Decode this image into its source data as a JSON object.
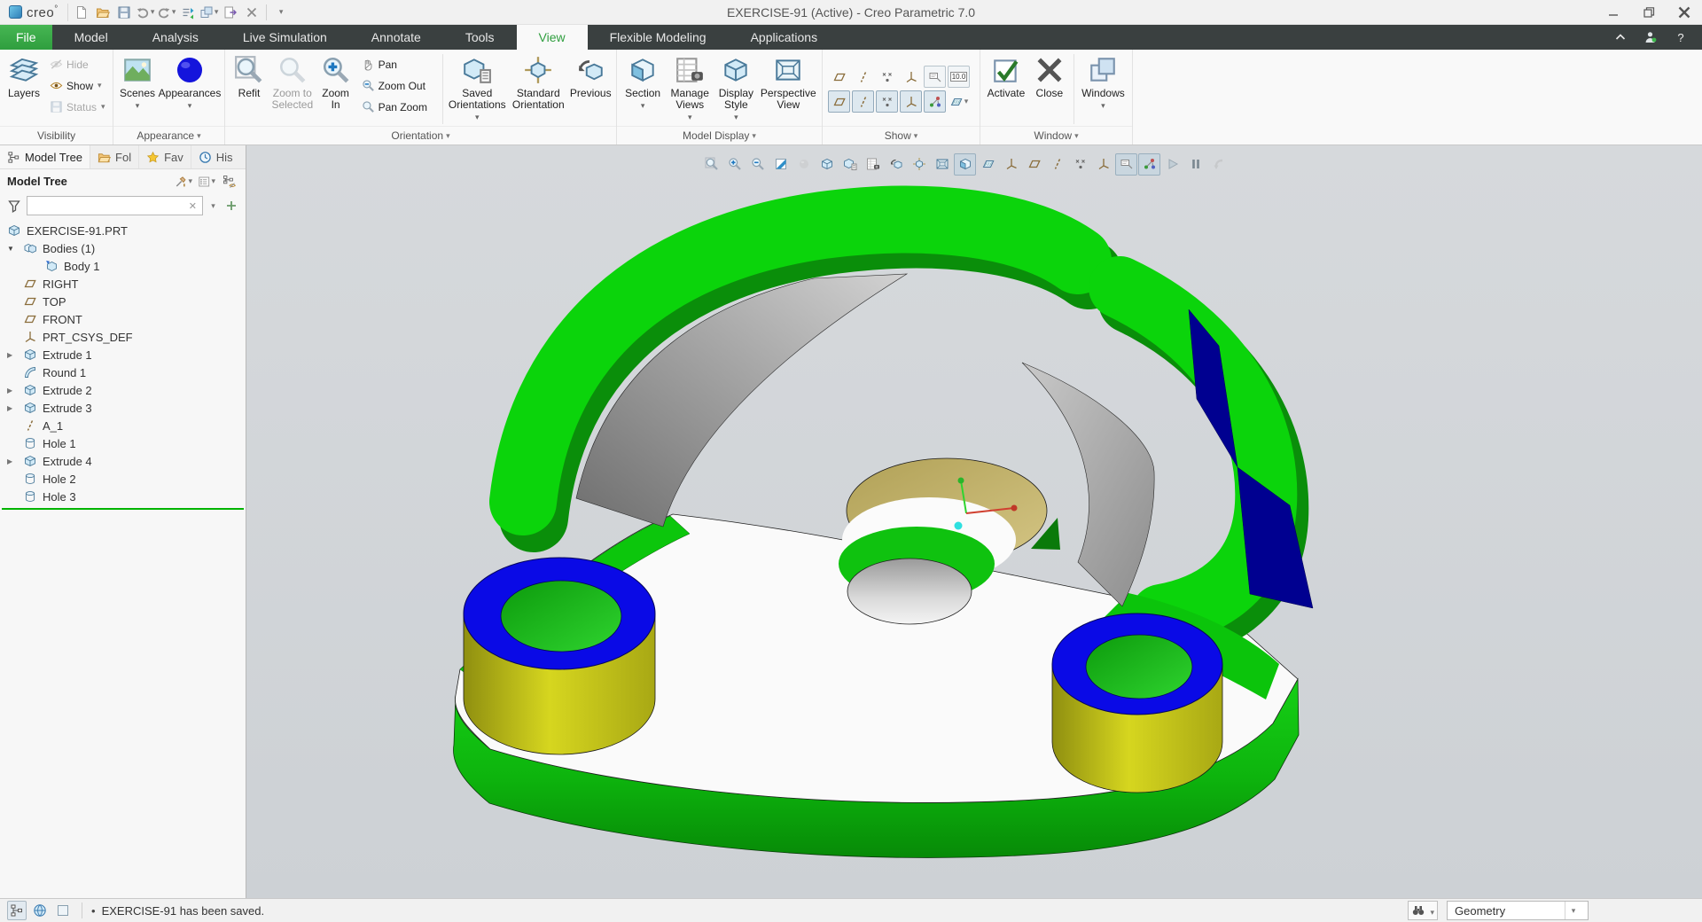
{
  "window": {
    "brand": "creo",
    "title": "EXERCISE-91 (Active) - Creo Parametric 7.0"
  },
  "quick_access_icons": [
    "new-file",
    "open",
    "save",
    "undo",
    "redo",
    "regenerate",
    "model-windows",
    "export",
    "close-window",
    "customize-toolbar"
  ],
  "tab_bar": {
    "tabs": [
      "File",
      "Model",
      "Analysis",
      "Live Simulation",
      "Annotate",
      "Tools",
      "View",
      "Flexible Modeling",
      "Applications"
    ],
    "active": "View",
    "help": "?"
  },
  "ribbon": {
    "visibility": {
      "label": "Visibility",
      "layers": "Layers",
      "hide": "Hide",
      "show": "Show",
      "status": "Status"
    },
    "appearance": {
      "label": "Appearance",
      "scenes": "Scenes",
      "appearances": "Appearances"
    },
    "orientation": {
      "label": "Orientation",
      "refit": "Refit",
      "zoom_to_selected": "Zoom to Selected",
      "zoom_in": "Zoom In",
      "pan": "Pan",
      "zoom_out": "Zoom Out",
      "pan_zoom": "Pan Zoom",
      "saved_orientations": "Saved Orientations",
      "standard_orientation": "Standard Orientation",
      "previous": "Previous"
    },
    "model_display": {
      "label": "Model Display",
      "section": "Section",
      "manage_views": "Manage Views",
      "display_style": "Display Style",
      "perspective_view": "Perspective View"
    },
    "show": {
      "label": "Show",
      "dim_value": "10.0",
      "icons_row1": [
        "plane-display",
        "axis-display",
        "point-display",
        "csys-display",
        "annotation-display",
        "dim-tolerance-display"
      ],
      "icons_row2": [
        "plane-tag-display",
        "axis-tag-display",
        "point-tag-display",
        "csys-tag-display",
        "3d-dragger",
        "shaded-section"
      ]
    },
    "window_group": {
      "label": "Window",
      "activate": "Activate",
      "close": "Close",
      "windows": "Windows"
    }
  },
  "tree_panel": {
    "tabs": [
      "Model Tree",
      "Fol",
      "Fav",
      "His"
    ],
    "header": "Model Tree",
    "header_icons": [
      "tree-tools",
      "tree-display-options",
      "show-hide-columns"
    ],
    "filter_icons": [
      "funnel",
      "clear",
      "filter-dropdown",
      "add-filter"
    ],
    "search_value": "",
    "items": [
      {
        "label": "EXERCISE-91.PRT",
        "icon": "part",
        "level": 0,
        "expander": "none"
      },
      {
        "label": "Bodies (1)",
        "icon": "bodies",
        "level": 1,
        "expander": "open"
      },
      {
        "label": "Body 1",
        "icon": "body",
        "level": 2,
        "expander": "none"
      },
      {
        "label": "RIGHT",
        "icon": "plane",
        "level": 1,
        "expander": "none"
      },
      {
        "label": "TOP",
        "icon": "plane",
        "level": 1,
        "expander": "none"
      },
      {
        "label": "FRONT",
        "icon": "plane",
        "level": 1,
        "expander": "none"
      },
      {
        "label": "PRT_CSYS_DEF",
        "icon": "csys",
        "level": 1,
        "expander": "none"
      },
      {
        "label": "Extrude 1",
        "icon": "extrude",
        "level": 1,
        "expander": "closed"
      },
      {
        "label": "Round 1",
        "icon": "round",
        "level": 1,
        "expander": "none"
      },
      {
        "label": "Extrude 2",
        "icon": "extrude",
        "level": 1,
        "expander": "closed"
      },
      {
        "label": "Extrude 3",
        "icon": "extrude",
        "level": 1,
        "expander": "closed"
      },
      {
        "label": "A_1",
        "icon": "axis",
        "level": 1,
        "expander": "none"
      },
      {
        "label": "Hole 1",
        "icon": "hole",
        "level": 1,
        "expander": "none"
      },
      {
        "label": "Extrude 4",
        "icon": "extrude",
        "level": 1,
        "expander": "closed"
      },
      {
        "label": "Hole 2",
        "icon": "hole",
        "level": 1,
        "expander": "none"
      },
      {
        "label": "Hole 3",
        "icon": "hole",
        "level": 1,
        "expander": "none"
      }
    ]
  },
  "graphics_toolbar": {
    "icons": [
      "refit",
      "zoom-in",
      "zoom-out",
      "repaint",
      "spin-center",
      "display-style",
      "saved-orientations",
      "view-manager",
      "last-orientation",
      "reorient",
      "perspective",
      "section-view",
      "xsec-hatch",
      "datum-display-filters",
      "plane-display",
      "axis-display",
      "point-display",
      "csys-display",
      "annotation-display",
      "3d-dragger",
      "analysis",
      "pause",
      "exit-transient-mode"
    ]
  },
  "status_bar": {
    "message": "EXERCISE-91 has been saved.",
    "left_icons": [
      "model-tree-toggle",
      "web-browser",
      "console"
    ],
    "selection_filter": "Geometry"
  },
  "colors": {
    "accent_green": "#35ad45",
    "model_green": "#0bd40b",
    "model_dark_green": "#0a8e0a",
    "model_blue_ring": "#0a0ae6",
    "model_yellow": "#c8c81e",
    "model_tan": "#c8b878",
    "model_navy": "#000090",
    "viewport_bg": "#d2d6d9"
  }
}
